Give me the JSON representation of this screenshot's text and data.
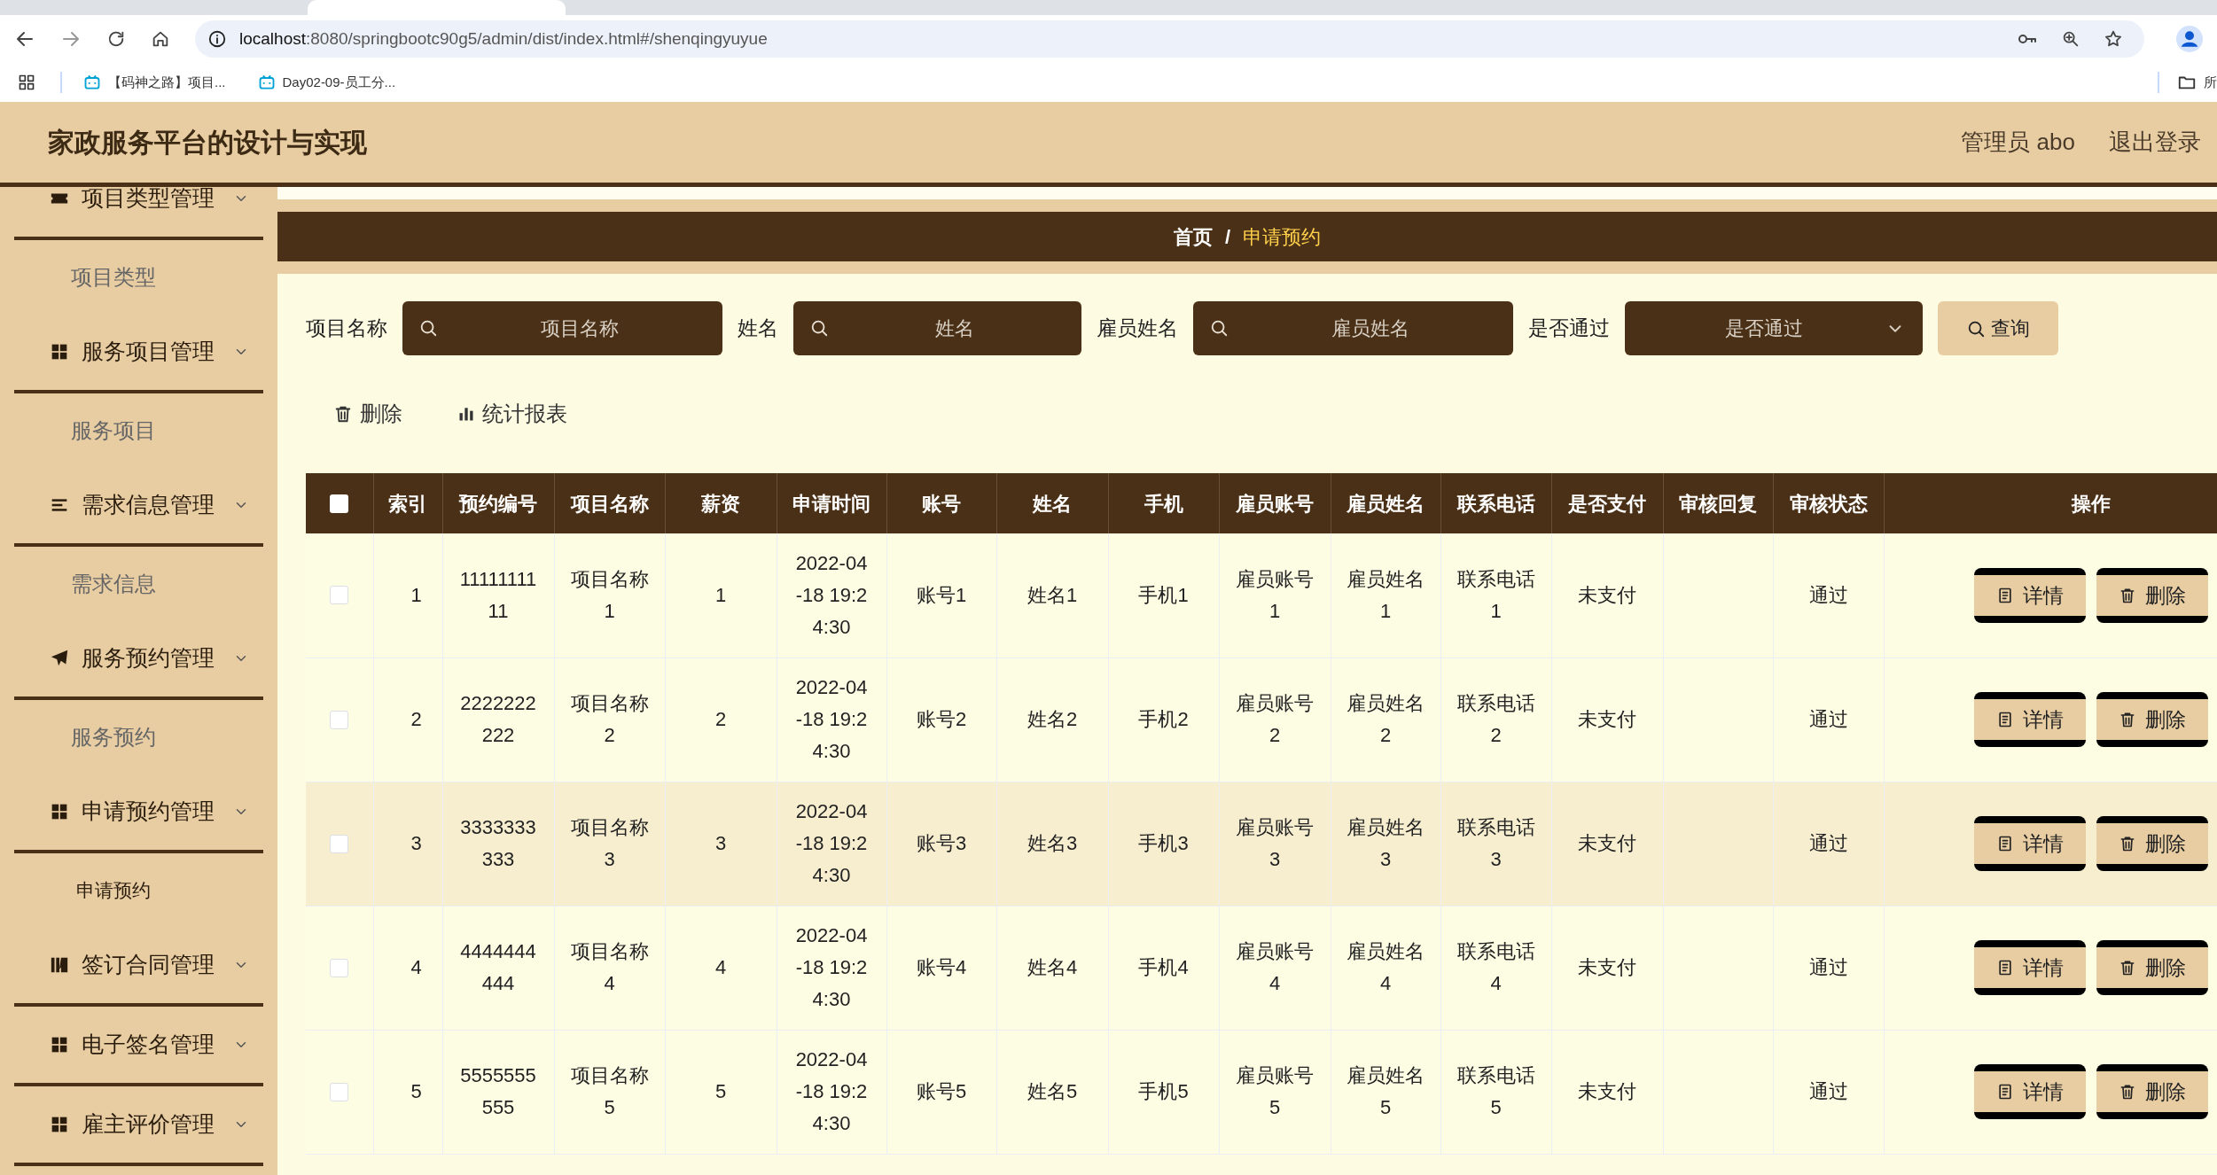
{
  "browser": {
    "url_host": "localhost",
    "url_path": ":8080/springbootc90g5/admin/dist/index.html#/shenqingyuyue",
    "bookmarks": [
      {
        "label": "【码神之路】项目..."
      },
      {
        "label": "Day02-09-员工分..."
      }
    ],
    "folder": "所"
  },
  "header": {
    "title": "家政服务平台的设计与实现",
    "user": "管理员 abo",
    "logout": "退出登录"
  },
  "sidebar": {
    "groups": [
      {
        "label": "项目类型管理",
        "children": [
          {
            "label": "项目类型",
            "selected": false
          }
        ]
      },
      {
        "label": "服务项目管理",
        "children": [
          {
            "label": "服务项目",
            "selected": false
          }
        ]
      },
      {
        "label": "需求信息管理",
        "children": [
          {
            "label": "需求信息",
            "selected": false
          }
        ]
      },
      {
        "label": "服务预约管理",
        "children": [
          {
            "label": "服务预约",
            "selected": false
          }
        ]
      },
      {
        "label": "申请预约管理",
        "children": [
          {
            "label": "申请预约",
            "selected": true
          }
        ]
      },
      {
        "label": "签订合同管理"
      },
      {
        "label": "电子签名管理"
      },
      {
        "label": "雇主评价管理"
      }
    ]
  },
  "breadcrumb": {
    "home": "首页",
    "separator": "/",
    "current": "申请预约"
  },
  "search": {
    "fields": [
      {
        "label": "项目名称",
        "placeholder": "项目名称",
        "kind": "text"
      },
      {
        "label": "姓名",
        "placeholder": "姓名",
        "kind": "text"
      },
      {
        "label": "雇员姓名",
        "placeholder": "雇员姓名",
        "kind": "text"
      },
      {
        "label": "是否通过",
        "placeholder": "是否通过",
        "kind": "select"
      }
    ],
    "button": "查询"
  },
  "actions": [
    {
      "label": "删除",
      "kind": "delete"
    },
    {
      "label": "统计报表",
      "kind": "chart"
    }
  ],
  "table": {
    "select_all_checked": false,
    "columns": [
      "索引",
      "预约编号",
      "项目名称",
      "薪资",
      "申请时间",
      "账号",
      "姓名",
      "手机",
      "雇员账号",
      "雇员姓名",
      "联系电话",
      "是否支付",
      "审核回复",
      "审核状态",
      "操作"
    ],
    "rows": [
      {
        "checked": false,
        "hovered": false,
        "cells": [
          "1",
          "1111111111",
          "项目名称1",
          "1",
          "2022-04-18 19:24:30",
          "账号1",
          "姓名1",
          "手机1",
          "雇员账号1",
          "雇员姓名1",
          "联系电话1",
          "未支付",
          "",
          "通过"
        ],
        "buttons": [
          {
            "label": "详情",
            "kind": "detail"
          },
          {
            "label": "删除",
            "kind": "delete"
          }
        ]
      },
      {
        "checked": false,
        "hovered": false,
        "cells": [
          "2",
          "2222222222",
          "项目名称2",
          "2",
          "2022-04-18 19:24:30",
          "账号2",
          "姓名2",
          "手机2",
          "雇员账号2",
          "雇员姓名2",
          "联系电话2",
          "未支付",
          "",
          "通过"
        ],
        "buttons": [
          {
            "label": "详情",
            "kind": "detail"
          },
          {
            "label": "删除",
            "kind": "delete"
          }
        ]
      },
      {
        "checked": false,
        "hovered": true,
        "cells": [
          "3",
          "3333333333",
          "项目名称3",
          "3",
          "2022-04-18 19:24:30",
          "账号3",
          "姓名3",
          "手机3",
          "雇员账号3",
          "雇员姓名3",
          "联系电话3",
          "未支付",
          "",
          "通过"
        ],
        "buttons": [
          {
            "label": "详情",
            "kind": "detail"
          },
          {
            "label": "删除",
            "kind": "delete"
          }
        ]
      },
      {
        "checked": false,
        "hovered": false,
        "cells": [
          "4",
          "4444444444",
          "项目名称4",
          "4",
          "2022-04-18 19:24:30",
          "账号4",
          "姓名4",
          "手机4",
          "雇员账号4",
          "雇员姓名4",
          "联系电话4",
          "未支付",
          "",
          "通过"
        ],
        "buttons": [
          {
            "label": "详情",
            "kind": "detail"
          },
          {
            "label": "删除",
            "kind": "delete"
          }
        ]
      },
      {
        "checked": false,
        "hovered": false,
        "cells": [
          "5",
          "5555555555",
          "项目名称5",
          "5",
          "2022-04-18 19:24:30",
          "账号5",
          "姓名5",
          "手机5",
          "雇员账号5",
          "雇员姓名5",
          "联系电话5",
          "未支付",
          "",
          "通过"
        ],
        "buttons": [
          {
            "label": "详情",
            "kind": "detail"
          },
          {
            "label": "删除",
            "kind": "delete"
          }
        ]
      }
    ]
  }
}
